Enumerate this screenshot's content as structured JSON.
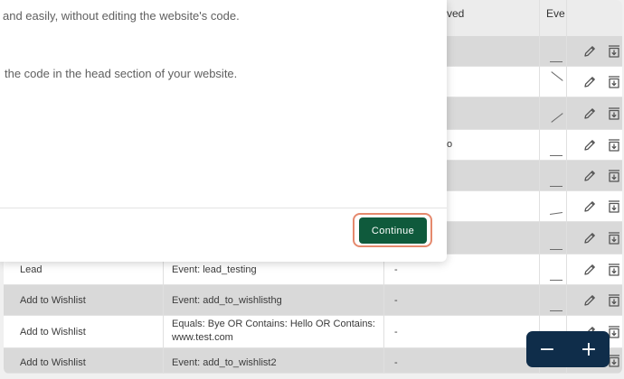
{
  "modal": {
    "line1": "and easily, without editing the website's code.",
    "line2": "the code in the head section of your website.",
    "continue_label": "Continue"
  },
  "table": {
    "headers": {
      "partial_col": "ved",
      "events_col": "Eve"
    },
    "partial_cell": "o",
    "rows": [
      {
        "name": "Lead",
        "condition": "Event: lead_testing",
        "value": "-"
      },
      {
        "name": "Add to Wishlist",
        "condition": "Event: add_to_wishlisthg",
        "value": "-"
      },
      {
        "name": "Add to Wishlist",
        "condition": "Equals: Bye OR Contains: Hello OR Contains: www.test.com",
        "value": "-"
      },
      {
        "name": "Add to Wishlist",
        "condition": "Event: add_to_wishlist2",
        "value": "-"
      }
    ]
  },
  "icons": {
    "edit": "pencil-icon",
    "download": "download-box-icon"
  },
  "zoom": {
    "minus": "−",
    "plus": "+"
  }
}
